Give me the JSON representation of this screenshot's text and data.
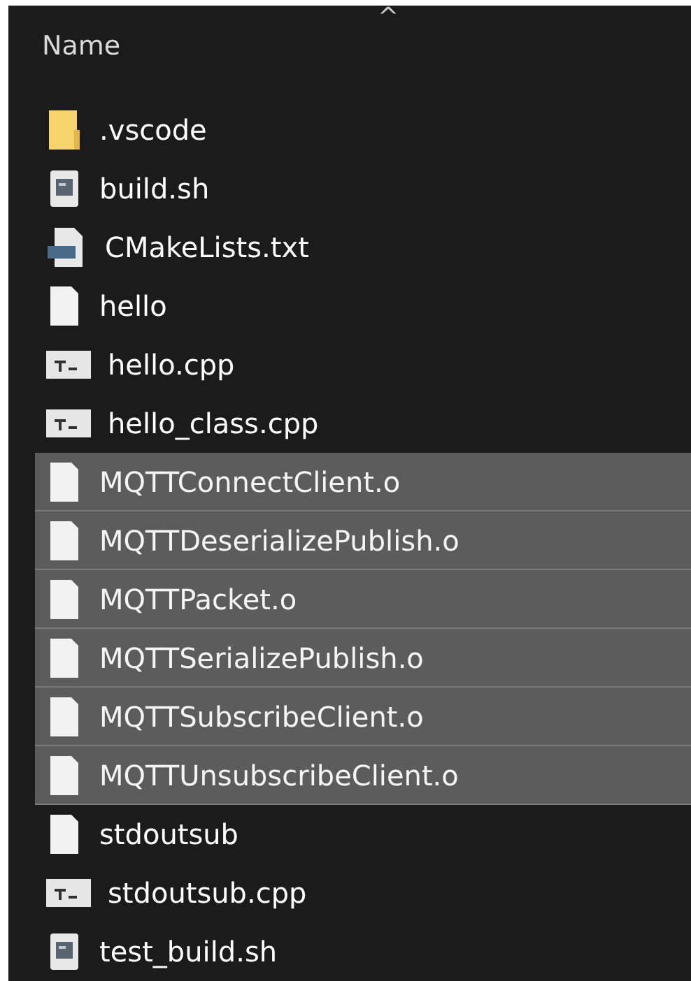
{
  "header": {
    "sort_indicator": "^",
    "column": "Name"
  },
  "files": [
    {
      "name": ".vscode",
      "kind": "folder",
      "selected": false
    },
    {
      "name": "build.sh",
      "kind": "script",
      "selected": false
    },
    {
      "name": "CMakeLists.txt",
      "kind": "text",
      "selected": false
    },
    {
      "name": "hello",
      "kind": "blank",
      "selected": false
    },
    {
      "name": "hello.cpp",
      "kind": "cpp",
      "selected": false
    },
    {
      "name": "hello_class.cpp",
      "kind": "cpp",
      "selected": false
    },
    {
      "name": "MQTTConnectClient.o",
      "kind": "blank",
      "selected": true
    },
    {
      "name": "MQTTDeserializePublish.o",
      "kind": "blank",
      "selected": true
    },
    {
      "name": "MQTTPacket.o",
      "kind": "blank",
      "selected": true
    },
    {
      "name": "MQTTSerializePublish.o",
      "kind": "blank",
      "selected": true
    },
    {
      "name": "MQTTSubscribeClient.o",
      "kind": "blank",
      "selected": true
    },
    {
      "name": "MQTTUnsubscribeClient.o",
      "kind": "blank",
      "selected": true
    },
    {
      "name": "stdoutsub",
      "kind": "blank",
      "selected": false
    },
    {
      "name": "stdoutsub.cpp",
      "kind": "cpp",
      "selected": false
    },
    {
      "name": "test_build.sh",
      "kind": "script",
      "selected": false
    }
  ]
}
